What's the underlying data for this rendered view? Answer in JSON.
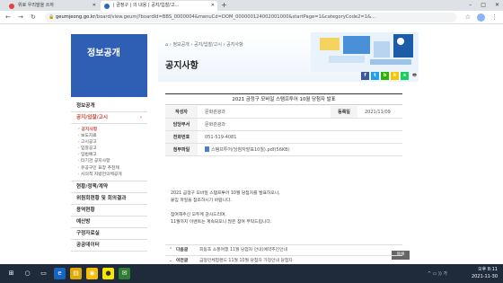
{
  "browser": {
    "tabs": [
      {
        "label": "위로 우리말을 쓰자"
      },
      {
        "label": "| 금정구 | 의 내용 | 공지/입찰/고..."
      }
    ],
    "new_tab": "+",
    "window_controls": [
      "–",
      "□",
      "✕"
    ],
    "nav": {
      "back": "←",
      "forward": "→",
      "reload": "↻"
    },
    "url_host": "geumjeong.go.kr",
    "url_path": "/board/view.geumj?boardId=BBS_0000004&menuCd=DOM_000000124002001000&startPage=1&categoryCode2=1&...",
    "addr_icons": [
      "☆",
      "⋮"
    ]
  },
  "sidebar": {
    "heading": "정보공개",
    "items": [
      {
        "label": "정보공개"
      },
      {
        "label": "공지/입찰/고시",
        "chevron": "›"
      }
    ],
    "subitems": [
      "· 공지사항",
      "· 보도자료",
      "· 고시공고",
      "· 입찰공고",
      "· 입법예고",
      "· 타기관 공지사항",
      "· 유공구민 표창 추천제",
      "· 시의적 지방언의체공개"
    ],
    "items_after": [
      {
        "label": "현황/정책/계약"
      },
      {
        "label": "위원회현황 및 회의결과"
      },
      {
        "label": "용역현황"
      },
      {
        "label": "예산방"
      },
      {
        "label": "구정자료실"
      },
      {
        "label": "공공데이터"
      }
    ]
  },
  "content": {
    "breadcrumb": {
      "home": "⌂",
      "sep": "›",
      "items": [
        "정보공개",
        "공지/입찰/고시",
        "공지사항"
      ]
    },
    "title": "공지사항",
    "share": [
      {
        "label": "f",
        "color": "#3b5998"
      },
      {
        "label": "t",
        "color": "#1da1f2"
      },
      {
        "label": "b",
        "color": "#2db400"
      },
      {
        "label": "k",
        "color": "#f7c600"
      },
      {
        "label": "s",
        "color": "#19ce60"
      }
    ],
    "print": "🖶",
    "post": {
      "title": "2021 금정구 모바일 스탬프투어 10월 당첨자 발표",
      "author_label": "작성자",
      "author": "문화관광과",
      "date_label": "등록일",
      "date": "2021/11/09",
      "dept_label": "담당부서",
      "dept": "문화관광과",
      "phone_label": "전화번호",
      "phone": "051-519-4081",
      "file_label": "첨부파일",
      "file": "스탬프투어(당첨자발표10월).pdf(56KB)"
    },
    "body": [
      "2021 금정구 모바일 스탬프투어 10월 당첨자를 발표하오니,",
      "붙임 파일을 참조하시기 바랍니다.",
      "",
      "참여해주신 모두께 감사드리며,",
      "11월까지 이벤트는 계속되오니 많은 참여 부탁드립니다."
    ],
    "list_button": "목록",
    "prev": {
      "arrow": "⌃",
      "label": "다음글",
      "title": "회동호 소풍여행 11월 당첨자 안내(예약추진안내"
    },
    "next": {
      "arrow": "⌄",
      "label": "이전글",
      "title": "금정민체험랜드 11월 10월 당첨자 가정안내 당첨자"
    }
  },
  "taskbar": {
    "icons": [
      {
        "label": "⊞",
        "color": "#1f2a3a"
      },
      {
        "label": "○",
        "color": "#1f2a3a"
      },
      {
        "label": "▭",
        "color": "#1f2a3a"
      },
      {
        "label": "e",
        "color": "#1565c0"
      },
      {
        "label": "▤",
        "color": "#e0a800"
      },
      {
        "label": "◉",
        "color": "#fbbc05"
      },
      {
        "label": "●",
        "color": "#f7e600"
      },
      {
        "label": "✉",
        "color": "#2e7d32"
      }
    ],
    "tray_icons": "^  ▭  ))  가",
    "time": "오후 8:11",
    "date": "2021-11-30"
  }
}
